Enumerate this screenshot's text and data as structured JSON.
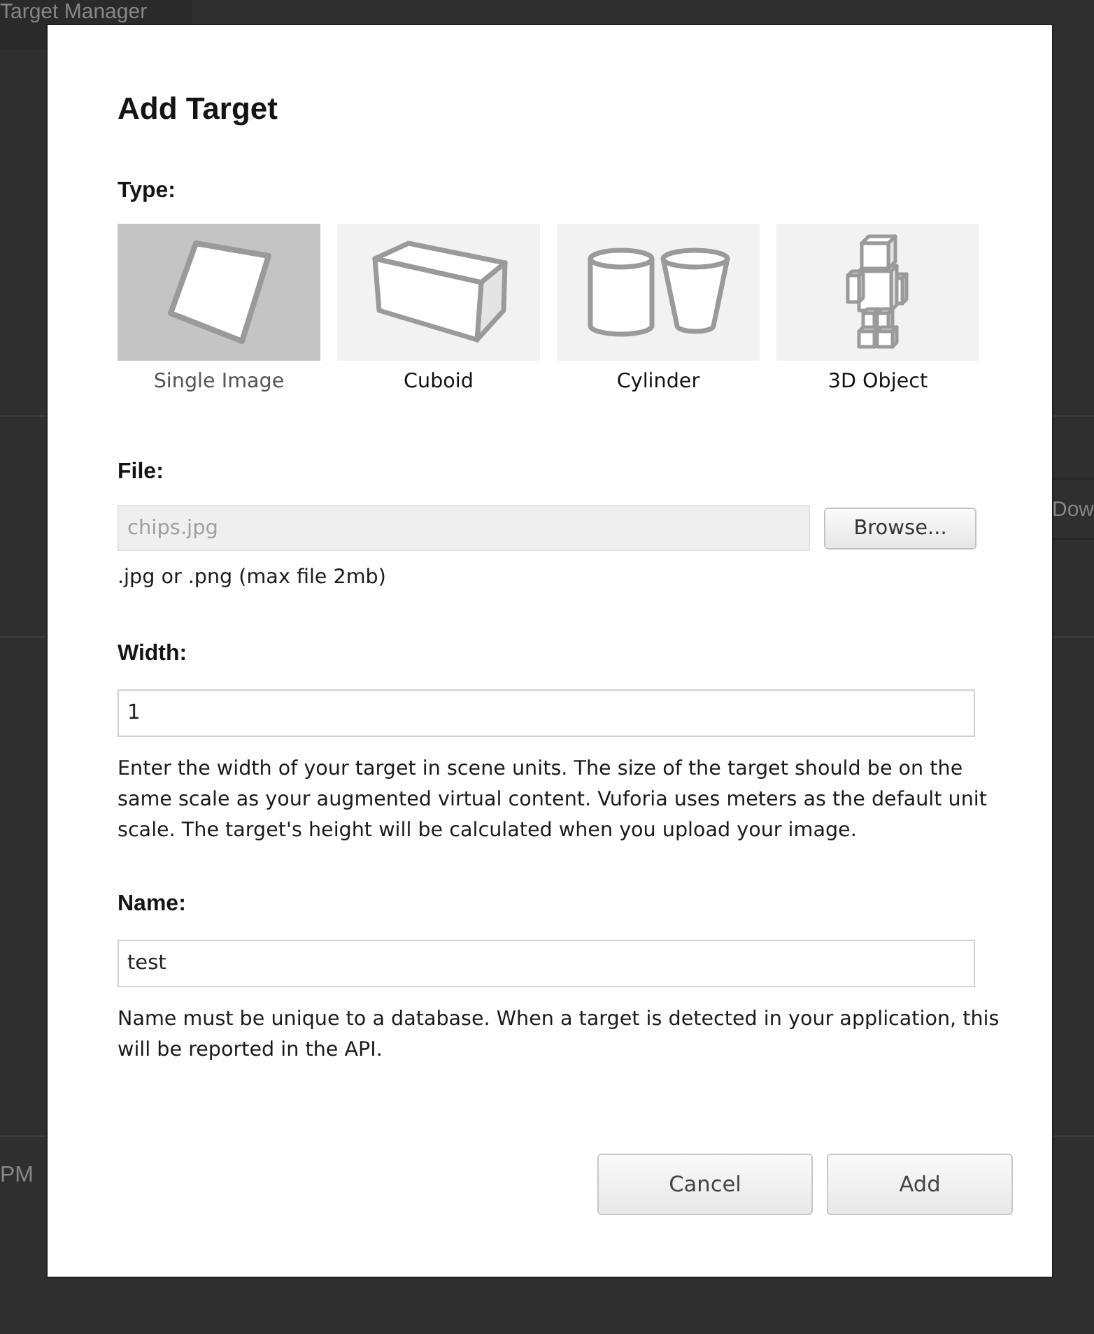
{
  "background": {
    "tab": "Target Manager",
    "row_button": "Dow",
    "row_text": "PM"
  },
  "dialog": {
    "title": "Add Target",
    "type": {
      "label": "Type:",
      "options": [
        {
          "kind": "image",
          "label": "Single Image",
          "selected": true
        },
        {
          "kind": "cuboid",
          "label": "Cuboid",
          "selected": false
        },
        {
          "kind": "cylinder",
          "label": "Cylinder",
          "selected": false
        },
        {
          "kind": "object",
          "label": "3D Object",
          "selected": false
        }
      ]
    },
    "file": {
      "label": "File:",
      "value": "chips.jpg",
      "disabled": true,
      "button": "Browse...",
      "hint": ".jpg or .png (max file 2mb)"
    },
    "width": {
      "label": "Width:",
      "value": "1",
      "help": "Enter the width of your target in scene units. The size of the target should be on the same scale as your augmented virtual content. Vuforia uses meters as the default unit scale. The target's height will be calculated when you upload your image."
    },
    "name": {
      "label": "Name:",
      "value": "test",
      "help": "Name must be unique to a database. When a target is detected in your application, this will be reported in the API."
    },
    "buttons": [
      {
        "label": "Cancel"
      },
      {
        "label": "Add"
      }
    ]
  }
}
